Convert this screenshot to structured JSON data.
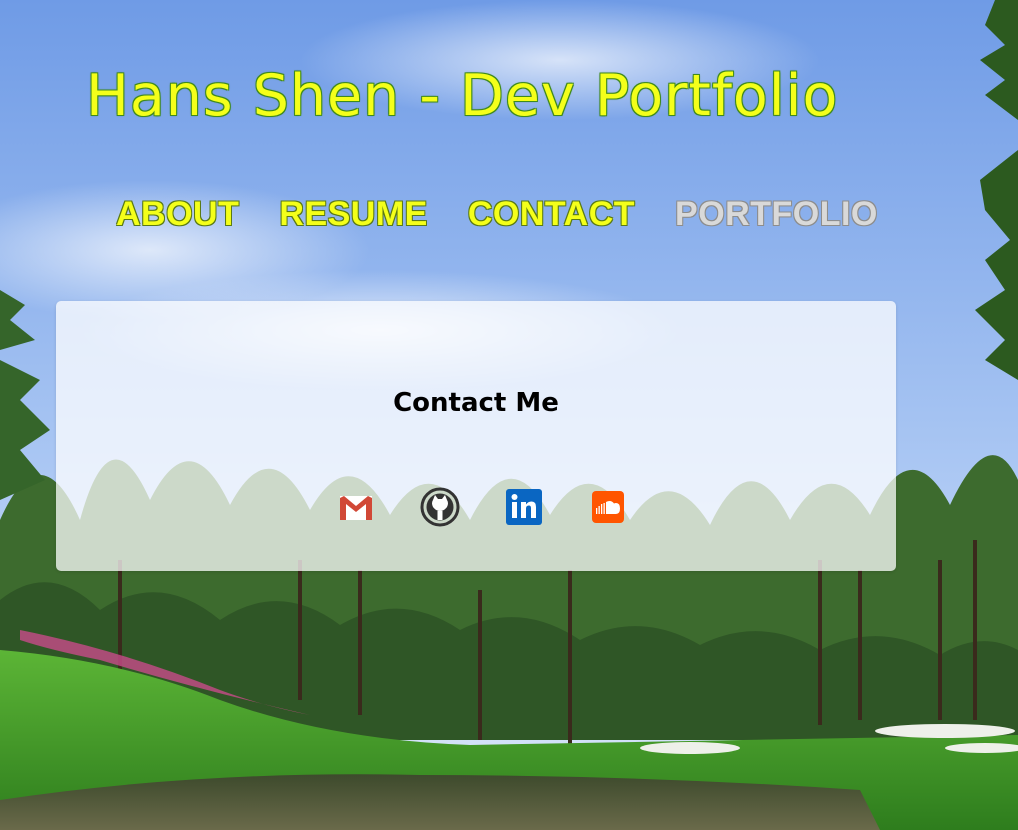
{
  "header": {
    "title": "Hans Shen - Dev Portfolio"
  },
  "nav": {
    "items": [
      {
        "label": "ABOUT",
        "active": true
      },
      {
        "label": "RESUME",
        "active": true
      },
      {
        "label": "CONTACT",
        "active": true
      },
      {
        "label": "PORTFOLIO",
        "active": false
      }
    ]
  },
  "contact": {
    "heading": "Contact Me",
    "links": [
      {
        "icon": "gmail-icon",
        "color": "#d14836"
      },
      {
        "icon": "github-icon",
        "color": "#333333"
      },
      {
        "icon": "linkedin-icon",
        "color": "#0a66c2"
      },
      {
        "icon": "soundcloud-icon",
        "color": "#ff5500"
      }
    ]
  },
  "colors": {
    "title": "#f4ff1a",
    "title_outline": "#3f8a1d",
    "nav_muted": "#d9d9d9",
    "sky_top": "#6f9be6",
    "grass": "#3d9a27"
  }
}
